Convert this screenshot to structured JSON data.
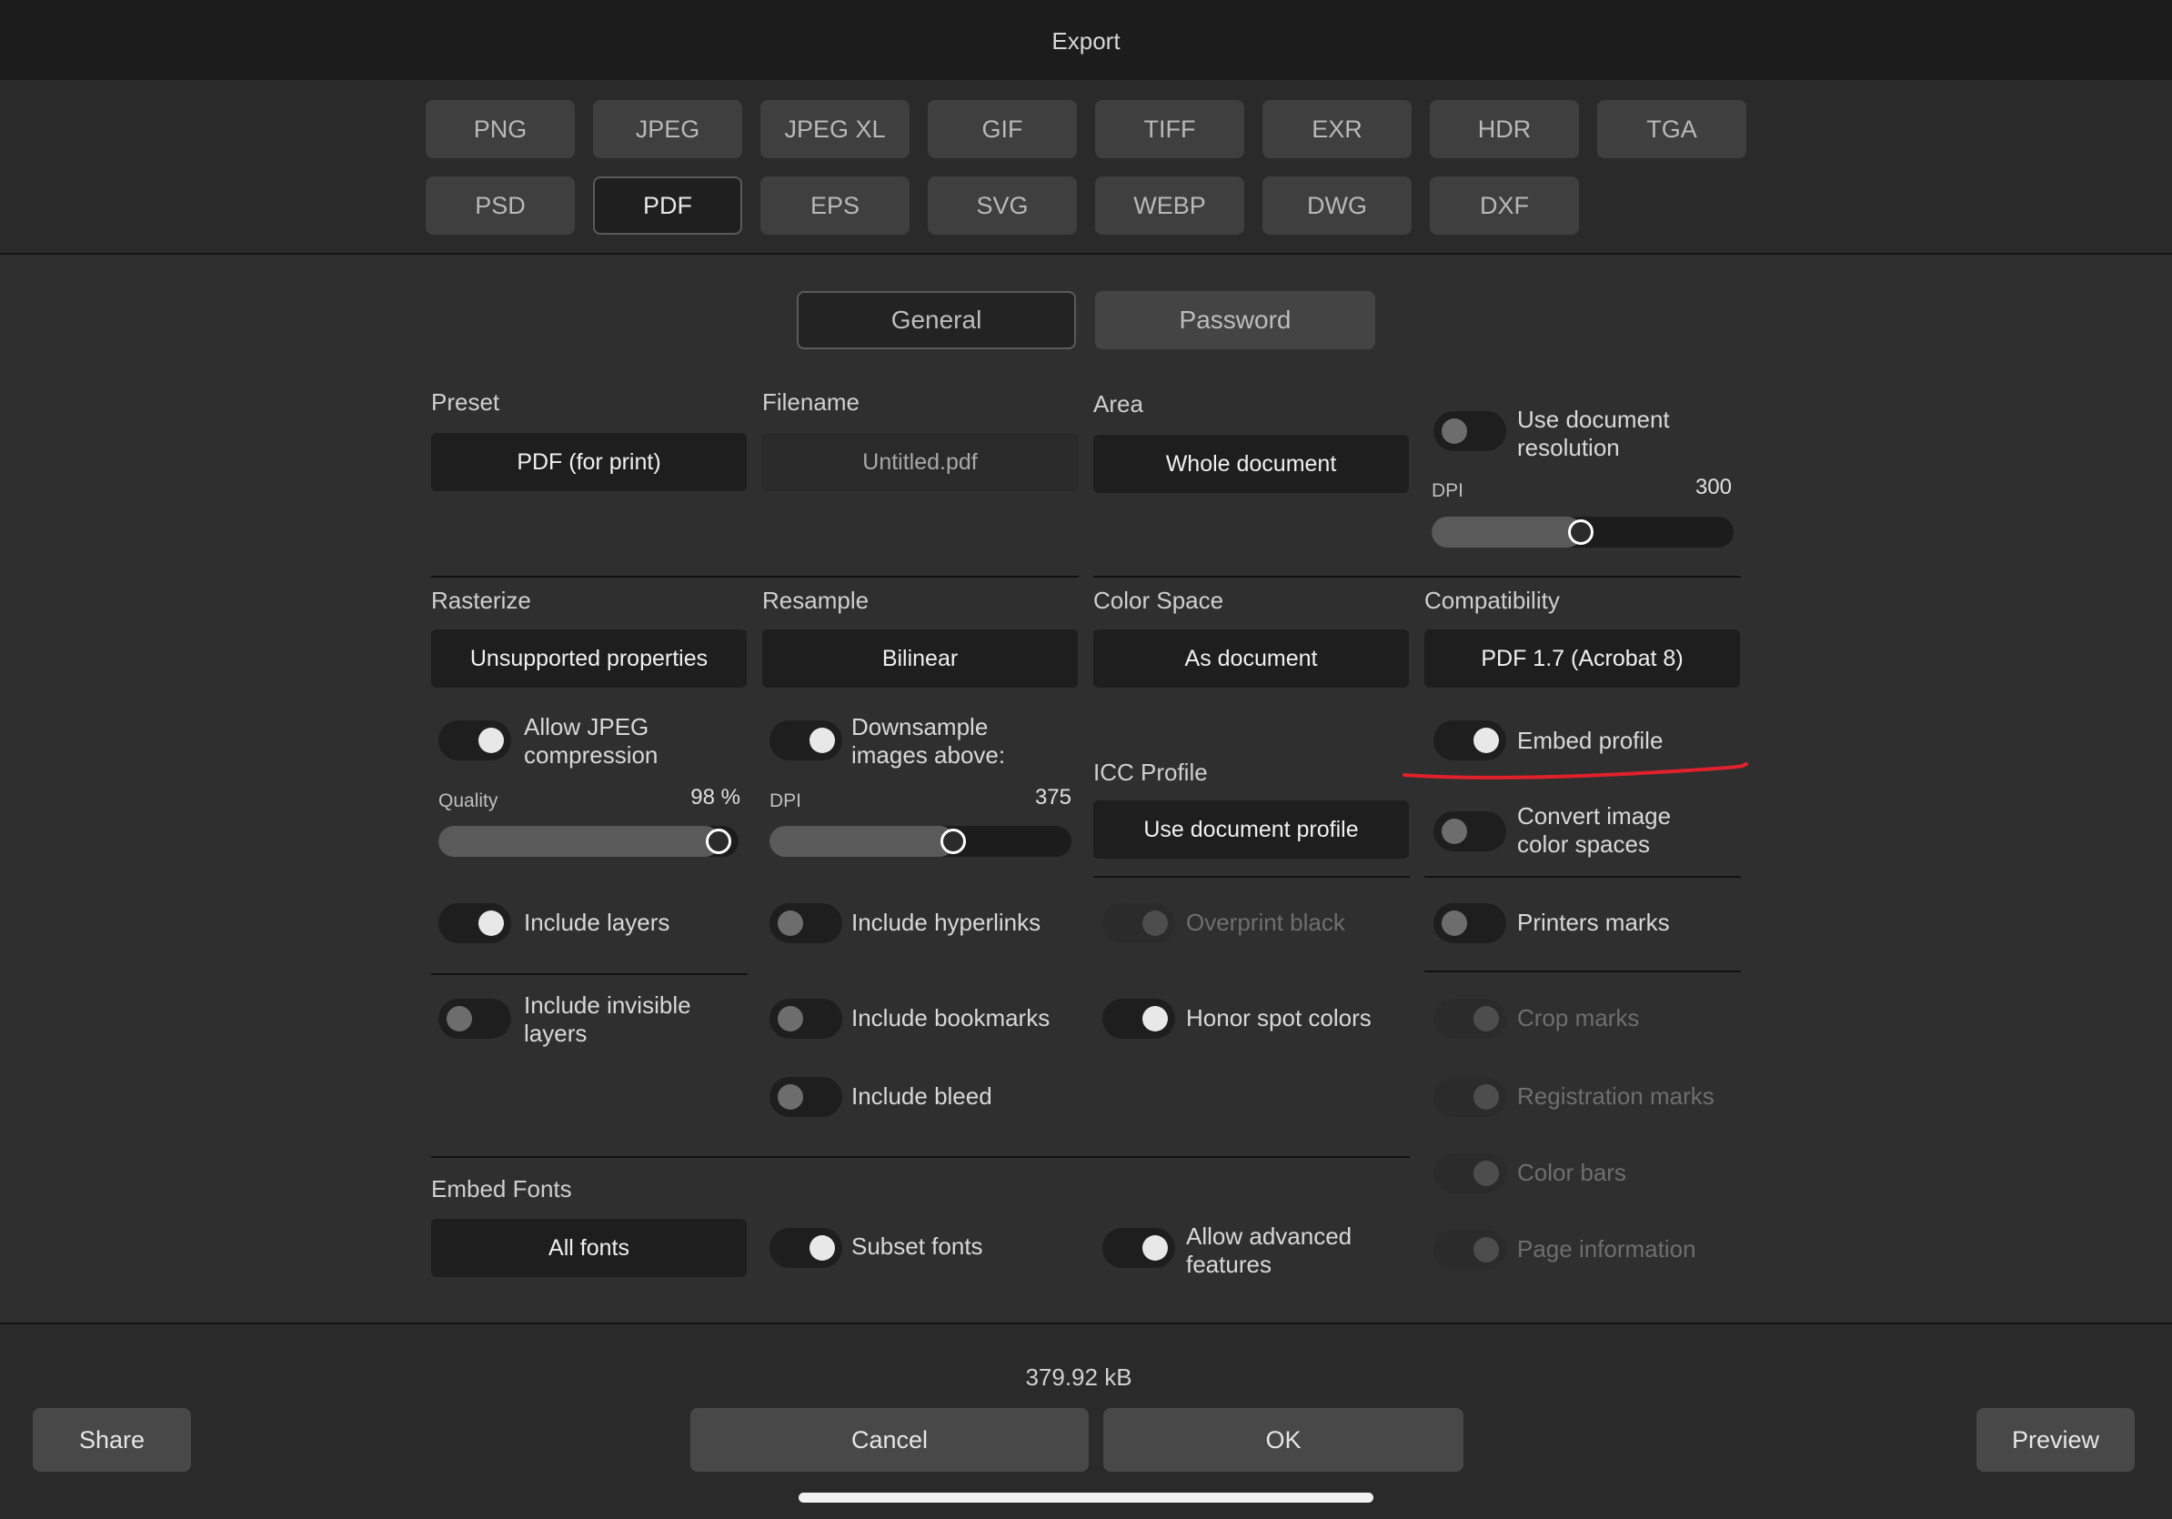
{
  "window": {
    "title": "Export"
  },
  "formats": {
    "row1": [
      "PNG",
      "JPEG",
      "JPEG XL",
      "GIF",
      "TIFF",
      "EXR",
      "HDR",
      "TGA"
    ],
    "row2": [
      "PSD",
      "PDF",
      "EPS",
      "SVG",
      "WEBP",
      "DWG",
      "DXF"
    ],
    "selected": "PDF"
  },
  "tabs": {
    "general": "General",
    "password": "Password",
    "selected": "General"
  },
  "preset": {
    "label": "Preset",
    "value": "PDF (for print)"
  },
  "filename": {
    "label": "Filename",
    "value": "Untitled.pdf"
  },
  "area": {
    "label": "Area",
    "value": "Whole document"
  },
  "use_doc_resolution": {
    "label_line1": "Use document",
    "label_line2": "resolution",
    "on": false
  },
  "dpi_main": {
    "label": "DPI",
    "value": "300",
    "fraction": 0.5
  },
  "rasterize": {
    "label": "Rasterize",
    "value": "Unsupported properties"
  },
  "resample": {
    "label": "Resample",
    "value": "Bilinear"
  },
  "color_space": {
    "label": "Color Space",
    "value": "As document"
  },
  "compatibility": {
    "label": "Compatibility",
    "value": "PDF 1.7 (Acrobat 8)"
  },
  "allow_jpeg": {
    "label_line1": "Allow JPEG",
    "label_line2": "compression",
    "on": true
  },
  "quality": {
    "label": "Quality",
    "value": "98 %",
    "fraction": 0.98
  },
  "downsample": {
    "label_line1": "Downsample",
    "label_line2": "images above:",
    "on": true
  },
  "dpi_downsample": {
    "label": "DPI",
    "value": "375",
    "fraction": 0.6
  },
  "icc_profile": {
    "label": "ICC Profile",
    "value": "Use document profile"
  },
  "embed_profile": {
    "label": "Embed profile",
    "on": true
  },
  "convert_color": {
    "label_line1": "Convert image",
    "label_line2": "color spaces",
    "on": false
  },
  "include_layers": {
    "label": "Include layers",
    "on": true
  },
  "include_hyperlinks": {
    "label": "Include hyperlinks",
    "on": false
  },
  "overprint_black": {
    "label": "Overprint black",
    "on": true,
    "disabled": true
  },
  "printers_marks": {
    "label": "Printers marks",
    "on": false
  },
  "include_invisible": {
    "label_line1": "Include invisible",
    "label_line2": "layers",
    "on": false
  },
  "include_bookmarks": {
    "label": "Include bookmarks",
    "on": false
  },
  "honor_spot": {
    "label": "Honor spot colors",
    "on": true
  },
  "crop_marks": {
    "label": "Crop marks",
    "on": true,
    "disabled": true
  },
  "include_bleed": {
    "label": "Include bleed",
    "on": false
  },
  "registration_marks": {
    "label": "Registration marks",
    "on": true,
    "disabled": true
  },
  "color_bars": {
    "label": "Color bars",
    "on": true,
    "disabled": true
  },
  "embed_fonts": {
    "label": "Embed Fonts",
    "value": "All fonts"
  },
  "subset_fonts": {
    "label": "Subset fonts",
    "on": true
  },
  "allow_advanced": {
    "label_line1": "Allow advanced",
    "label_line2": "features",
    "on": true
  },
  "page_information": {
    "label": "Page information",
    "on": true,
    "disabled": true
  },
  "footer": {
    "file_size": "379.92 kB",
    "share": "Share",
    "cancel": "Cancel",
    "ok": "OK",
    "preview": "Preview"
  },
  "annotation_color": "#e0212b"
}
